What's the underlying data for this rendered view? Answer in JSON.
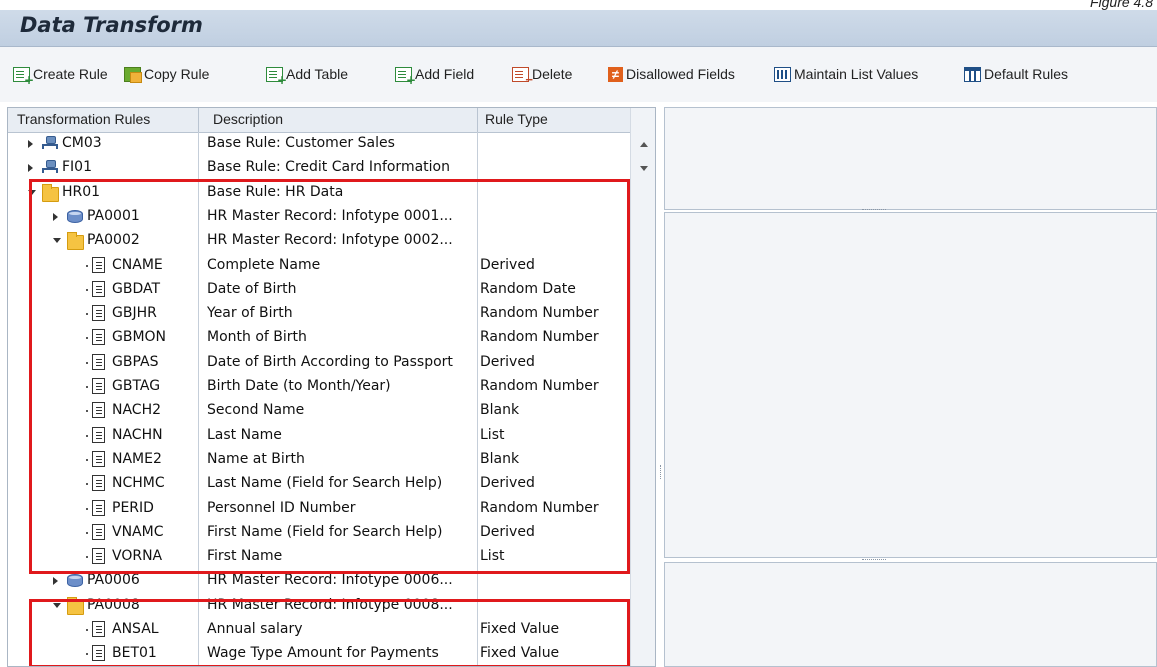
{
  "caption": "Figure 4.8",
  "title": "Data Transform",
  "toolbar": [
    {
      "label": "Create Rule",
      "icon": "create-rule-icon"
    },
    {
      "label": "Copy Rule",
      "icon": "copy-rule-icon"
    },
    {
      "label": "Add Table",
      "icon": "add-table-icon"
    },
    {
      "label": "Add Field",
      "icon": "add-field-icon"
    },
    {
      "label": "Delete",
      "icon": "delete-icon"
    },
    {
      "label": "Disallowed Fields",
      "icon": "not-equal-icon"
    },
    {
      "label": "Maintain List Values",
      "icon": "list-values-icon"
    },
    {
      "label": "Default Rules",
      "icon": "default-rules-icon"
    }
  ],
  "columns": {
    "rules": "Transformation Rules",
    "description": "Description",
    "type": "Rule Type"
  },
  "rows": [
    {
      "id": "CM03",
      "desc": "Base Rule: Customer Sales",
      "type": "",
      "kind": "rule",
      "state": "collapsed"
    },
    {
      "id": "FI01",
      "desc": "Base Rule: Credit Card Information",
      "type": "",
      "kind": "rule",
      "state": "collapsed"
    },
    {
      "id": "HR01",
      "desc": "Base Rule: HR Data",
      "type": "",
      "kind": "folder",
      "state": "expanded"
    },
    {
      "id": "PA0001",
      "desc": "HR Master Record: Infotype 0001...",
      "type": "",
      "kind": "table",
      "state": "collapsed"
    },
    {
      "id": "PA0002",
      "desc": "HR Master Record: Infotype 0002...",
      "type": "",
      "kind": "folder",
      "state": "expanded"
    },
    {
      "id": "CNAME",
      "desc": "Complete Name",
      "type": "Derived",
      "kind": "field"
    },
    {
      "id": "GBDAT",
      "desc": "Date of Birth",
      "type": "Random Date",
      "kind": "field"
    },
    {
      "id": "GBJHR",
      "desc": "Year of Birth",
      "type": "Random Number",
      "kind": "field"
    },
    {
      "id": "GBMON",
      "desc": "Month of Birth",
      "type": "Random Number",
      "kind": "field"
    },
    {
      "id": "GBPAS",
      "desc": "Date of Birth According to Passport",
      "type": "Derived",
      "kind": "field"
    },
    {
      "id": "GBTAG",
      "desc": "Birth Date (to Month/Year)",
      "type": "Random Number",
      "kind": "field"
    },
    {
      "id": "NACH2",
      "desc": "Second Name",
      "type": "Blank",
      "kind": "field"
    },
    {
      "id": "NACHN",
      "desc": "Last Name",
      "type": "List",
      "kind": "field"
    },
    {
      "id": "NAME2",
      "desc": "Name at Birth",
      "type": "Blank",
      "kind": "field"
    },
    {
      "id": "NCHMC",
      "desc": "Last Name (Field for Search Help)",
      "type": "Derived",
      "kind": "field"
    },
    {
      "id": "PERID",
      "desc": "Personnel ID Number",
      "type": "Random Number",
      "kind": "field"
    },
    {
      "id": "VNAMC",
      "desc": "First Name (Field for Search Help)",
      "type": "Derived",
      "kind": "field"
    },
    {
      "id": "VORNA",
      "desc": "First Name",
      "type": "List",
      "kind": "field"
    },
    {
      "id": "PA0006",
      "desc": "HR Master Record: Infotype 0006...",
      "type": "",
      "kind": "table",
      "state": "collapsed"
    },
    {
      "id": "PA0008",
      "desc": "HR Master Record: Infotype 0008...",
      "type": "",
      "kind": "folder",
      "state": "expanded"
    },
    {
      "id": "ANSAL",
      "desc": "Annual salary",
      "type": "Fixed Value",
      "kind": "field"
    },
    {
      "id": "BET01",
      "desc": "Wage Type Amount for Payments",
      "type": "Fixed Value",
      "kind": "field"
    }
  ],
  "colors": {
    "highlight": "#e0191c",
    "titlebar": "#c7d5e6"
  }
}
